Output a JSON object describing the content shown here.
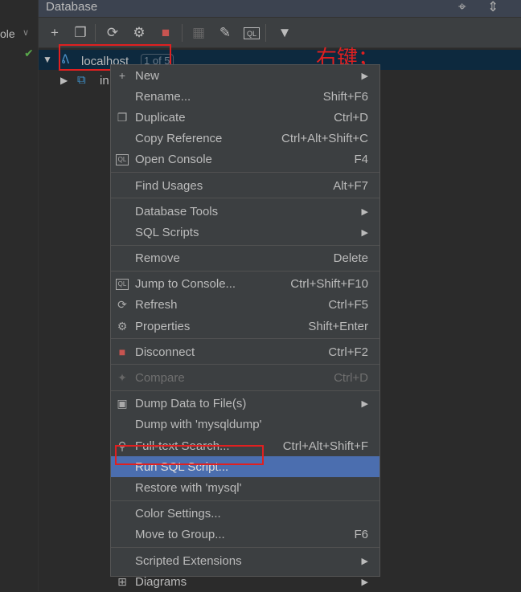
{
  "left": {
    "label": "ole"
  },
  "panel": {
    "title": "Database"
  },
  "tree": {
    "host": "localhost",
    "badge": "1 of 5",
    "child": "in"
  },
  "annotation": "右键；",
  "menu": [
    {
      "label": "New",
      "icon": "plus-icon",
      "glyph": "+",
      "submenu": true
    },
    {
      "label": "Rename...",
      "shortcut": "Shift+F6"
    },
    {
      "label": "Duplicate",
      "shortcut": "Ctrl+D",
      "icon": "duplicate-icon",
      "glyph": "❐"
    },
    {
      "label": "Copy Reference",
      "shortcut": "Ctrl+Alt+Shift+C"
    },
    {
      "label": "Open Console",
      "shortcut": "F4",
      "icon": "console-icon",
      "glyph": "QL"
    },
    {
      "sep": true
    },
    {
      "label": "Find Usages",
      "shortcut": "Alt+F7"
    },
    {
      "sep": true
    },
    {
      "label": "Database Tools",
      "submenu": true
    },
    {
      "label": "SQL Scripts",
      "submenu": true
    },
    {
      "sep": true
    },
    {
      "label": "Remove",
      "shortcut": "Delete"
    },
    {
      "sep": true
    },
    {
      "label": "Jump to Console...",
      "shortcut": "Ctrl+Shift+F10",
      "icon": "console-icon",
      "glyph": "QL"
    },
    {
      "label": "Refresh",
      "shortcut": "Ctrl+F5",
      "icon": "refresh-icon",
      "glyph": "⟳"
    },
    {
      "label": "Properties",
      "shortcut": "Shift+Enter",
      "icon": "properties-icon",
      "glyph": "⚙"
    },
    {
      "sep": true
    },
    {
      "label": "Disconnect",
      "shortcut": "Ctrl+F2",
      "icon": "stop-icon",
      "glyph": "■"
    },
    {
      "sep": true
    },
    {
      "label": "Compare",
      "shortcut": "Ctrl+D",
      "icon": "compare-icon",
      "glyph": "✦",
      "disabled": true
    },
    {
      "sep": true
    },
    {
      "label": "Dump Data to File(s)",
      "icon": "save-icon",
      "glyph": "▣",
      "submenu": true
    },
    {
      "label": "Dump with 'mysqldump'"
    },
    {
      "label": "Full-text Search...",
      "shortcut": "Ctrl+Alt+Shift+F",
      "icon": "search-icon",
      "glyph": "⚲"
    },
    {
      "label": "Run SQL Script...",
      "highlighted": true
    },
    {
      "label": "Restore with 'mysql'"
    },
    {
      "sep": true
    },
    {
      "label": "Color Settings..."
    },
    {
      "label": "Move to Group...",
      "shortcut": "F6"
    },
    {
      "sep": true
    },
    {
      "label": "Scripted Extensions",
      "submenu": true
    },
    {
      "label": "Diagrams",
      "icon": "diagram-icon",
      "glyph": "⊞",
      "submenu": true
    }
  ]
}
